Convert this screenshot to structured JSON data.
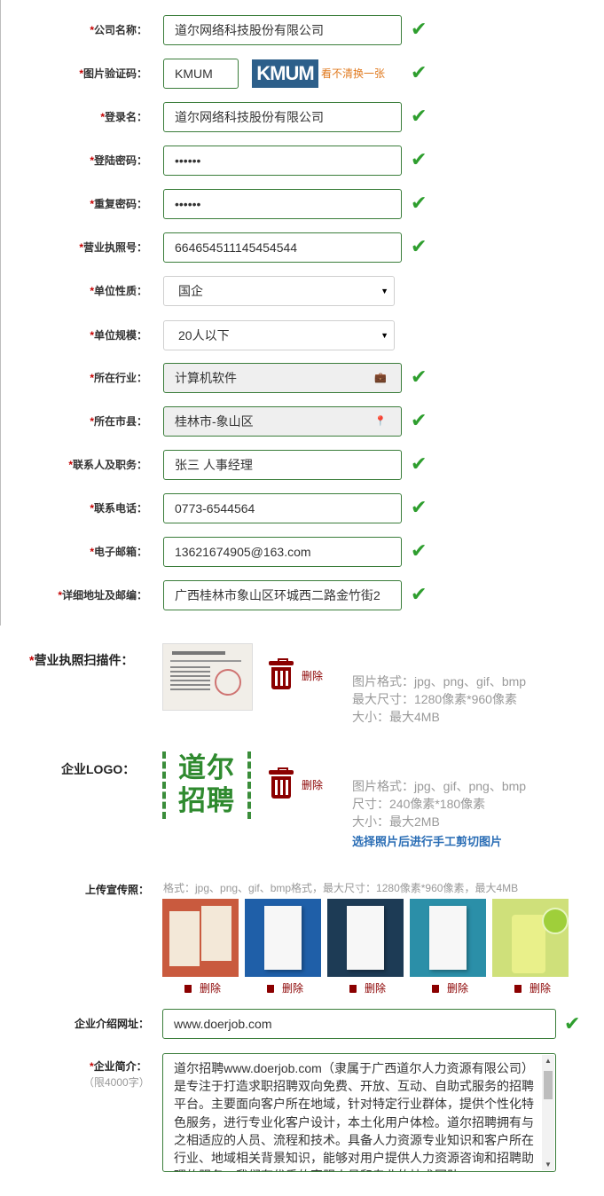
{
  "form": {
    "rows": [
      {
        "label": "公司名称：",
        "value": "道尔网络科技股份有限公司",
        "valid": true
      },
      {
        "label": "图片验证码：",
        "value": "KMUM",
        "valid": true
      },
      {
        "label": "登录名：",
        "value": "道尔网络科技股份有限公司",
        "valid": true
      },
      {
        "label": "登陆密码：",
        "value": "••••••",
        "valid": true
      },
      {
        "label": "重复密码：",
        "value": "••••••",
        "valid": true
      },
      {
        "label": "营业执照号：",
        "value": "664654511145454544",
        "valid": true
      },
      {
        "label": "单位性质：",
        "value": "国企",
        "valid": false
      },
      {
        "label": "单位规模：",
        "value": "20人以下",
        "valid": false
      },
      {
        "label": "所在行业：",
        "value": "计算机软件",
        "valid": true
      },
      {
        "label": "所在市县：",
        "value": "桂林市-象山区",
        "valid": true
      },
      {
        "label": "联系人及职务：",
        "value": "张三 人事经理",
        "valid": true
      },
      {
        "label": "联系电话：",
        "value": "0773-6544564",
        "valid": true
      },
      {
        "label": "电子邮箱：",
        "value": "13621674905@163.com",
        "valid": true
      },
      {
        "label": "详细地址及邮编：",
        "value": "广西桂林市象山区环城西二路金竹街2",
        "valid": true
      }
    ],
    "required_mark": "*",
    "captcha_text": "KMUM",
    "captcha_refresh": "看不清换一张",
    "check_glyph": "✔"
  },
  "license_upload": {
    "label": "营业执照扫描件：",
    "delete": "删除",
    "hints": [
      "图片格式：jpg、png、gif、bmp",
      "最大尺寸：1280像素*960像素",
      "大小：最大4MB"
    ]
  },
  "logo_upload": {
    "label": "企业LOGO：",
    "logo_text": [
      "道尔",
      "招聘"
    ],
    "delete": "删除",
    "hints": [
      "图片格式：jpg、gif、png、bmp",
      "尺寸：240像素*180像素",
      "大小：最大2MB"
    ],
    "crop_link": "选择照片后进行手工剪切图片"
  },
  "promo": {
    "label": "上传宣传照：",
    "note": "格式：jpg、png、gif、bmp格式，最大尺寸：1280像素*960像素，最大4MB",
    "delete": "删除",
    "photos": [
      {
        "bg": "#c95a3e"
      },
      {
        "bg": "#1f5fa8"
      },
      {
        "bg": "#1d3b55"
      },
      {
        "bg": "#2b8fa8"
      },
      {
        "bg": "#cfe07a"
      }
    ]
  },
  "website": {
    "label": "企业介绍网址：",
    "value": "www.doerjob.com"
  },
  "intro": {
    "label": "企业简介：",
    "limit": "（限4000字）",
    "text": "道尔招聘www.doerjob.com（隶属于广西道尔人力资源有限公司）是专注于打造求职招聘双向免费、开放、互动、自助式服务的招聘平台。主要面向客户所在地域，针对特定行业群体，提供个性化特色服务，进行专业化客户设计，本土化用户体检。道尔招聘拥有与之相适应的人员、流程和技术。具备人力资源专业知识和客户所在行业、地域相关背景知识，能够对用户提供人力资源咨询和招聘助理的服务。我们有优秀的客服人员和专业的技术团队。"
  }
}
